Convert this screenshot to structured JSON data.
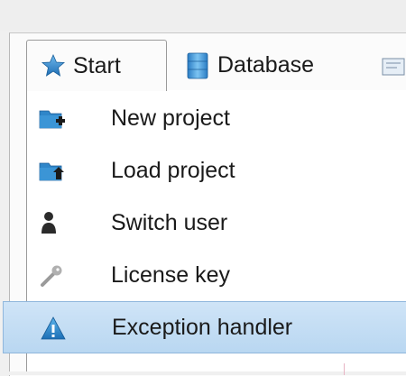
{
  "tabs": [
    {
      "label": "Start",
      "icon": "star-icon"
    },
    {
      "label": "Database",
      "icon": "database-icon"
    },
    {
      "label": "",
      "icon": "partial-icon"
    }
  ],
  "menu": {
    "items": [
      {
        "label": "New project",
        "icon": "new-project-icon"
      },
      {
        "label": "Load project",
        "icon": "load-project-icon"
      },
      {
        "label": "Switch user",
        "icon": "user-icon"
      },
      {
        "label": "License key",
        "icon": "key-icon"
      },
      {
        "label": "Exception handler",
        "icon": "warning-icon"
      }
    ],
    "selected_index": 4
  },
  "colors": {
    "selected_bg": "#c3ddf4",
    "selected_border": "#8fb6dc",
    "icon_blue": "#2f86c9"
  }
}
